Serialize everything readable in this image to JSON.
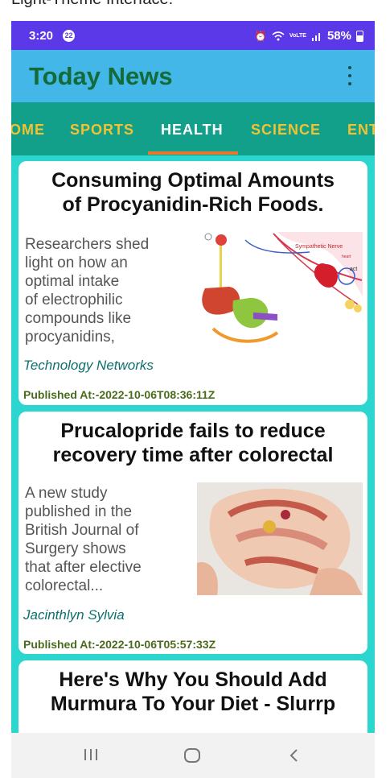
{
  "caption": "Light-Theme Interface:",
  "status": {
    "time": "3:20",
    "notifications": "22",
    "signal_text": "VoLTE",
    "battery": "58%"
  },
  "app": {
    "title": "Today News",
    "overflow_icon": "more-vert-icon"
  },
  "tabs": [
    {
      "label": "HOME",
      "shown": "OME",
      "active": false
    },
    {
      "label": "SPORTS",
      "shown": "SPORTS",
      "active": false
    },
    {
      "label": "HEALTH",
      "shown": "HEALTH",
      "active": true
    },
    {
      "label": "SCIENCE",
      "shown": "SCIENCE",
      "active": false
    },
    {
      "label": "ENTERTAINMENT",
      "shown": "ENT",
      "active": false
    }
  ],
  "articles": [
    {
      "title_line1": "Consuming Optimal Amounts",
      "title_line2": "of Procyanidin-Rich Foods.",
      "desc": [
        "Researchers shed",
        "light on how an",
        "optimal intake",
        "of electrophilic",
        "compounds like",
        "procyanidins,"
      ],
      "source": "Technology Networks",
      "published": "Published At:-2022-10-06T08:36:11Z",
      "image_labels": {
        "nerve": "Sympathetic Nerve",
        "heart": "heart",
        "act": "act"
      }
    },
    {
      "title_line1": "Prucalopride fails to reduce",
      "title_line2": "recovery time after colorectal",
      "desc": [
        "A new study",
        "published in the",
        "British Journal of",
        "Surgery shows",
        "that after elective",
        "colorectal..."
      ],
      "source": "Jacinthlyn Sylvia",
      "published": "Published At:-2022-10-06T05:57:33Z"
    },
    {
      "title_line1": "Here's Why You Should Add",
      "title_line2": "Murmura To Your Diet - Slurrp"
    }
  ],
  "colors": {
    "status_bar": "#5b38e8",
    "app_bar": "#43b7e8",
    "title": "#146b3a",
    "tab_bar": "#12a08a",
    "tab_text": "#f2c230",
    "tab_indicator": "#e3782e",
    "background": "#2bd6cf",
    "source_text": "#0e6f6f",
    "published_text": "#4a6b1c"
  },
  "nav": {
    "recents_icon": "recents-icon",
    "home_icon": "home-icon",
    "back_icon": "back-icon"
  }
}
